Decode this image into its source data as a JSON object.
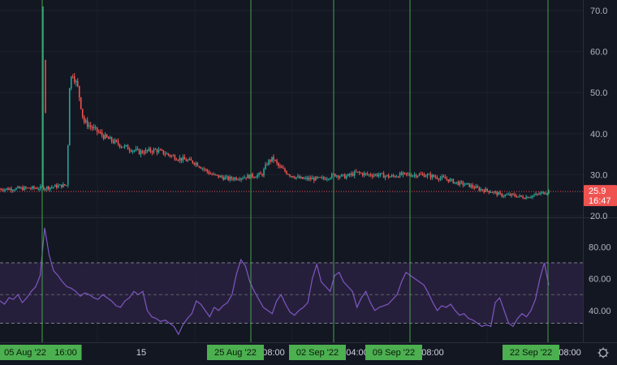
{
  "chart_data": [
    {
      "type": "candlestick",
      "name": "price",
      "y_ticks": [
        "70.0",
        "60.0",
        "50.0",
        "40.0",
        "30.0",
        "20.0"
      ],
      "ylim": [
        20,
        71
      ],
      "last_price": {
        "value": 25.9,
        "label": "25.9",
        "countdown": "16:47"
      },
      "colors": {
        "up": "#26a69a",
        "down": "#ef5350",
        "price_line": "#ef5350"
      },
      "path": [
        [
          0,
          26.5
        ],
        [
          0.08,
          26.8
        ],
        [
          0.12,
          27.5
        ],
        [
          0.125,
          52
        ],
        [
          0.13,
          55
        ],
        [
          0.14,
          51
        ],
        [
          0.15,
          43
        ],
        [
          0.17,
          41
        ],
        [
          0.19,
          39
        ],
        [
          0.22,
          37
        ],
        [
          0.25,
          35.5
        ],
        [
          0.28,
          36
        ],
        [
          0.3,
          35
        ],
        [
          0.32,
          34
        ],
        [
          0.35,
          33
        ],
        [
          0.38,
          30
        ],
        [
          0.41,
          29
        ],
        [
          0.44,
          29.5
        ],
        [
          0.47,
          30
        ],
        [
          0.48,
          33
        ],
        [
          0.49,
          34
        ],
        [
          0.5,
          32
        ],
        [
          0.52,
          30
        ],
        [
          0.54,
          29
        ],
        [
          0.56,
          29
        ],
        [
          0.58,
          29
        ],
        [
          0.6,
          30
        ],
        [
          0.62,
          29.5
        ],
        [
          0.64,
          30.5
        ],
        [
          0.66,
          30
        ],
        [
          0.68,
          30
        ],
        [
          0.7,
          29.5
        ],
        [
          0.72,
          30
        ],
        [
          0.74,
          30
        ],
        [
          0.76,
          30
        ],
        [
          0.78,
          29.5
        ],
        [
          0.8,
          29
        ],
        [
          0.82,
          28
        ],
        [
          0.84,
          27.5
        ],
        [
          0.86,
          26.5
        ],
        [
          0.88,
          26
        ],
        [
          0.9,
          25
        ],
        [
          0.92,
          25
        ],
        [
          0.94,
          24.5
        ],
        [
          0.96,
          25
        ],
        [
          0.985,
          26
        ]
      ]
    },
    {
      "type": "line",
      "name": "oscillator",
      "y_ticks": [
        "80.00",
        "60.00",
        "40.00"
      ],
      "ylim": [
        20,
        95
      ],
      "band": [
        32,
        70
      ],
      "midline": 50,
      "colors": {
        "line": "#7e57c2",
        "band_fill": "#2a2140"
      },
      "values": [
        46,
        44,
        48,
        47,
        50,
        45,
        48,
        52,
        55,
        62,
        92,
        75,
        65,
        62,
        58,
        55,
        54,
        52,
        49,
        51,
        50,
        48,
        47,
        50,
        48,
        46,
        43,
        42,
        46,
        48,
        52,
        50,
        52,
        40,
        36,
        35,
        33,
        34,
        32,
        30,
        25,
        31,
        35,
        38,
        46,
        44,
        40,
        36,
        42,
        40,
        43,
        45,
        50,
        63,
        72,
        68,
        58,
        52,
        47,
        42,
        40,
        38,
        46,
        50,
        44,
        39,
        37,
        40,
        42,
        45,
        60,
        69,
        58,
        55,
        52,
        62,
        64,
        58,
        55,
        52,
        42,
        48,
        52,
        45,
        40,
        42,
        43,
        44,
        47,
        50,
        58,
        64,
        62,
        60,
        58,
        56,
        51,
        45,
        40,
        43,
        42,
        44,
        40,
        37,
        38,
        35,
        34,
        32,
        30,
        31,
        30,
        45,
        48,
        40,
        32,
        30,
        35,
        38,
        36,
        40,
        47,
        60,
        70,
        56
      ]
    }
  ],
  "time_axis": {
    "ticks": [
      {
        "label": "15",
        "x": 174
      },
      {
        "label": "08:00",
        "x": 337
      },
      {
        "label": "04:00",
        "x": 440
      },
      {
        "label": "08:00",
        "x": 533
      },
      {
        "label": "08:00",
        "x": 702
      }
    ],
    "date_labels": [
      {
        "label": "05 Aug '22",
        "x": 31
      },
      {
        "label": "16:00",
        "x": 81
      },
      {
        "label": "25 Aug '22",
        "x": 290
      },
      {
        "label": "02 Sep '22",
        "x": 391
      },
      {
        "label": "09 Sep '22",
        "x": 485
      },
      {
        "label": "22 Sep '22",
        "x": 654
      }
    ]
  },
  "markers": [
    52,
    309,
    411,
    505,
    675
  ],
  "colors": {
    "background": "#131722",
    "grid": "#1e222d",
    "marker": "#4caf50",
    "date_badge": "#4caf50"
  },
  "settings_icon": "gear-icon"
}
